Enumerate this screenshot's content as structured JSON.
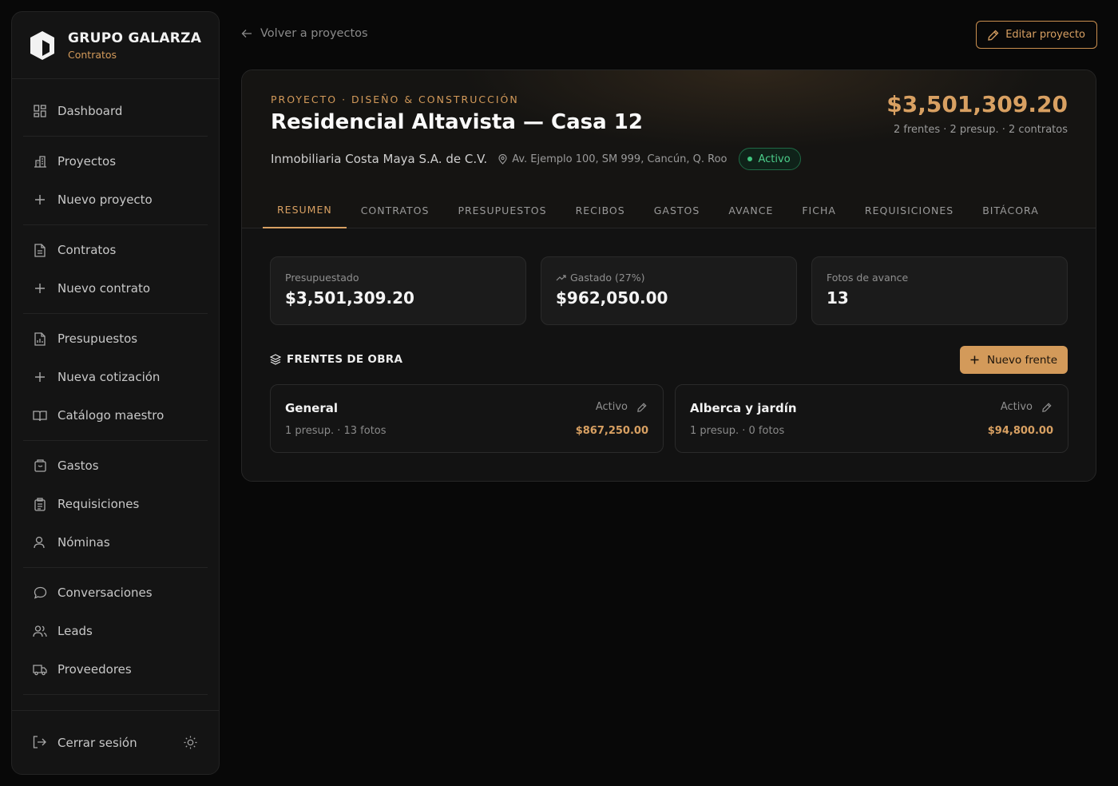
{
  "brand": {
    "name": "GRUPO GALARZA",
    "subtitle": "Contratos"
  },
  "sidebar": {
    "groups": [
      [
        {
          "label": "Dashboard",
          "icon": "dashboard-icon"
        }
      ],
      [
        {
          "label": "Proyectos",
          "icon": "building-icon"
        },
        {
          "label": "Nuevo proyecto",
          "icon": "plus-icon"
        }
      ],
      [
        {
          "label": "Contratos",
          "icon": "document-icon"
        },
        {
          "label": "Nuevo contrato",
          "icon": "plus-icon"
        }
      ],
      [
        {
          "label": "Presupuestos",
          "icon": "spreadsheet-icon"
        },
        {
          "label": "Nueva cotización",
          "icon": "plus-icon"
        },
        {
          "label": "Catálogo maestro",
          "icon": "book-icon"
        }
      ],
      [
        {
          "label": "Gastos",
          "icon": "wallet-icon"
        },
        {
          "label": "Requisiciones",
          "icon": "clipboard-icon"
        },
        {
          "label": "Nóminas",
          "icon": "person-icon"
        }
      ],
      [
        {
          "label": "Conversaciones",
          "icon": "chat-icon"
        },
        {
          "label": "Leads",
          "icon": "users-icon"
        },
        {
          "label": "Proveedores",
          "icon": "truck-icon"
        }
      ]
    ],
    "logout_label": "Cerrar sesión"
  },
  "header": {
    "back_label": "Volver a proyectos",
    "edit_label": "Editar proyecto"
  },
  "project": {
    "eyebrow": "PROYECTO · DISEÑO & CONSTRUCCIÓN",
    "title": "Residencial Altavista — Casa 12",
    "client": "Inmobiliaria Costa Maya S.A. de C.V.",
    "address": "Av. Ejemplo 100, SM 999, Cancún, Q. Roo",
    "status": "Activo",
    "total": "$3,501,309.20",
    "summary": "2 frentes · 2 presup. · 2 contratos"
  },
  "tabs": [
    "RESUMEN",
    "CONTRATOS",
    "PRESUPUESTOS",
    "RECIBOS",
    "GASTOS",
    "AVANCE",
    "FICHA",
    "REQUISICIONES",
    "BITÁCORA"
  ],
  "active_tab": "RESUMEN",
  "stats": [
    {
      "label": "Presupuestado",
      "value": "$3,501,309.20"
    },
    {
      "label": "Gastado (27%)",
      "value": "$962,050.00"
    },
    {
      "label": "Fotos de avance",
      "value": "13"
    }
  ],
  "fronts_section": {
    "title": "FRENTES DE OBRA",
    "add_label": "Nuevo frente"
  },
  "fronts": [
    {
      "name": "General",
      "status": "Activo",
      "detail": "1 presup. · 13 fotos",
      "amount": "$867,250.00"
    },
    {
      "name": "Alberca y jardín",
      "status": "Activo",
      "detail": "1 presup. · 0 fotos",
      "amount": "$94,800.00"
    }
  ],
  "colors": {
    "accent": "#d39a5a",
    "success": "#3fc47e",
    "background": "#080808"
  }
}
